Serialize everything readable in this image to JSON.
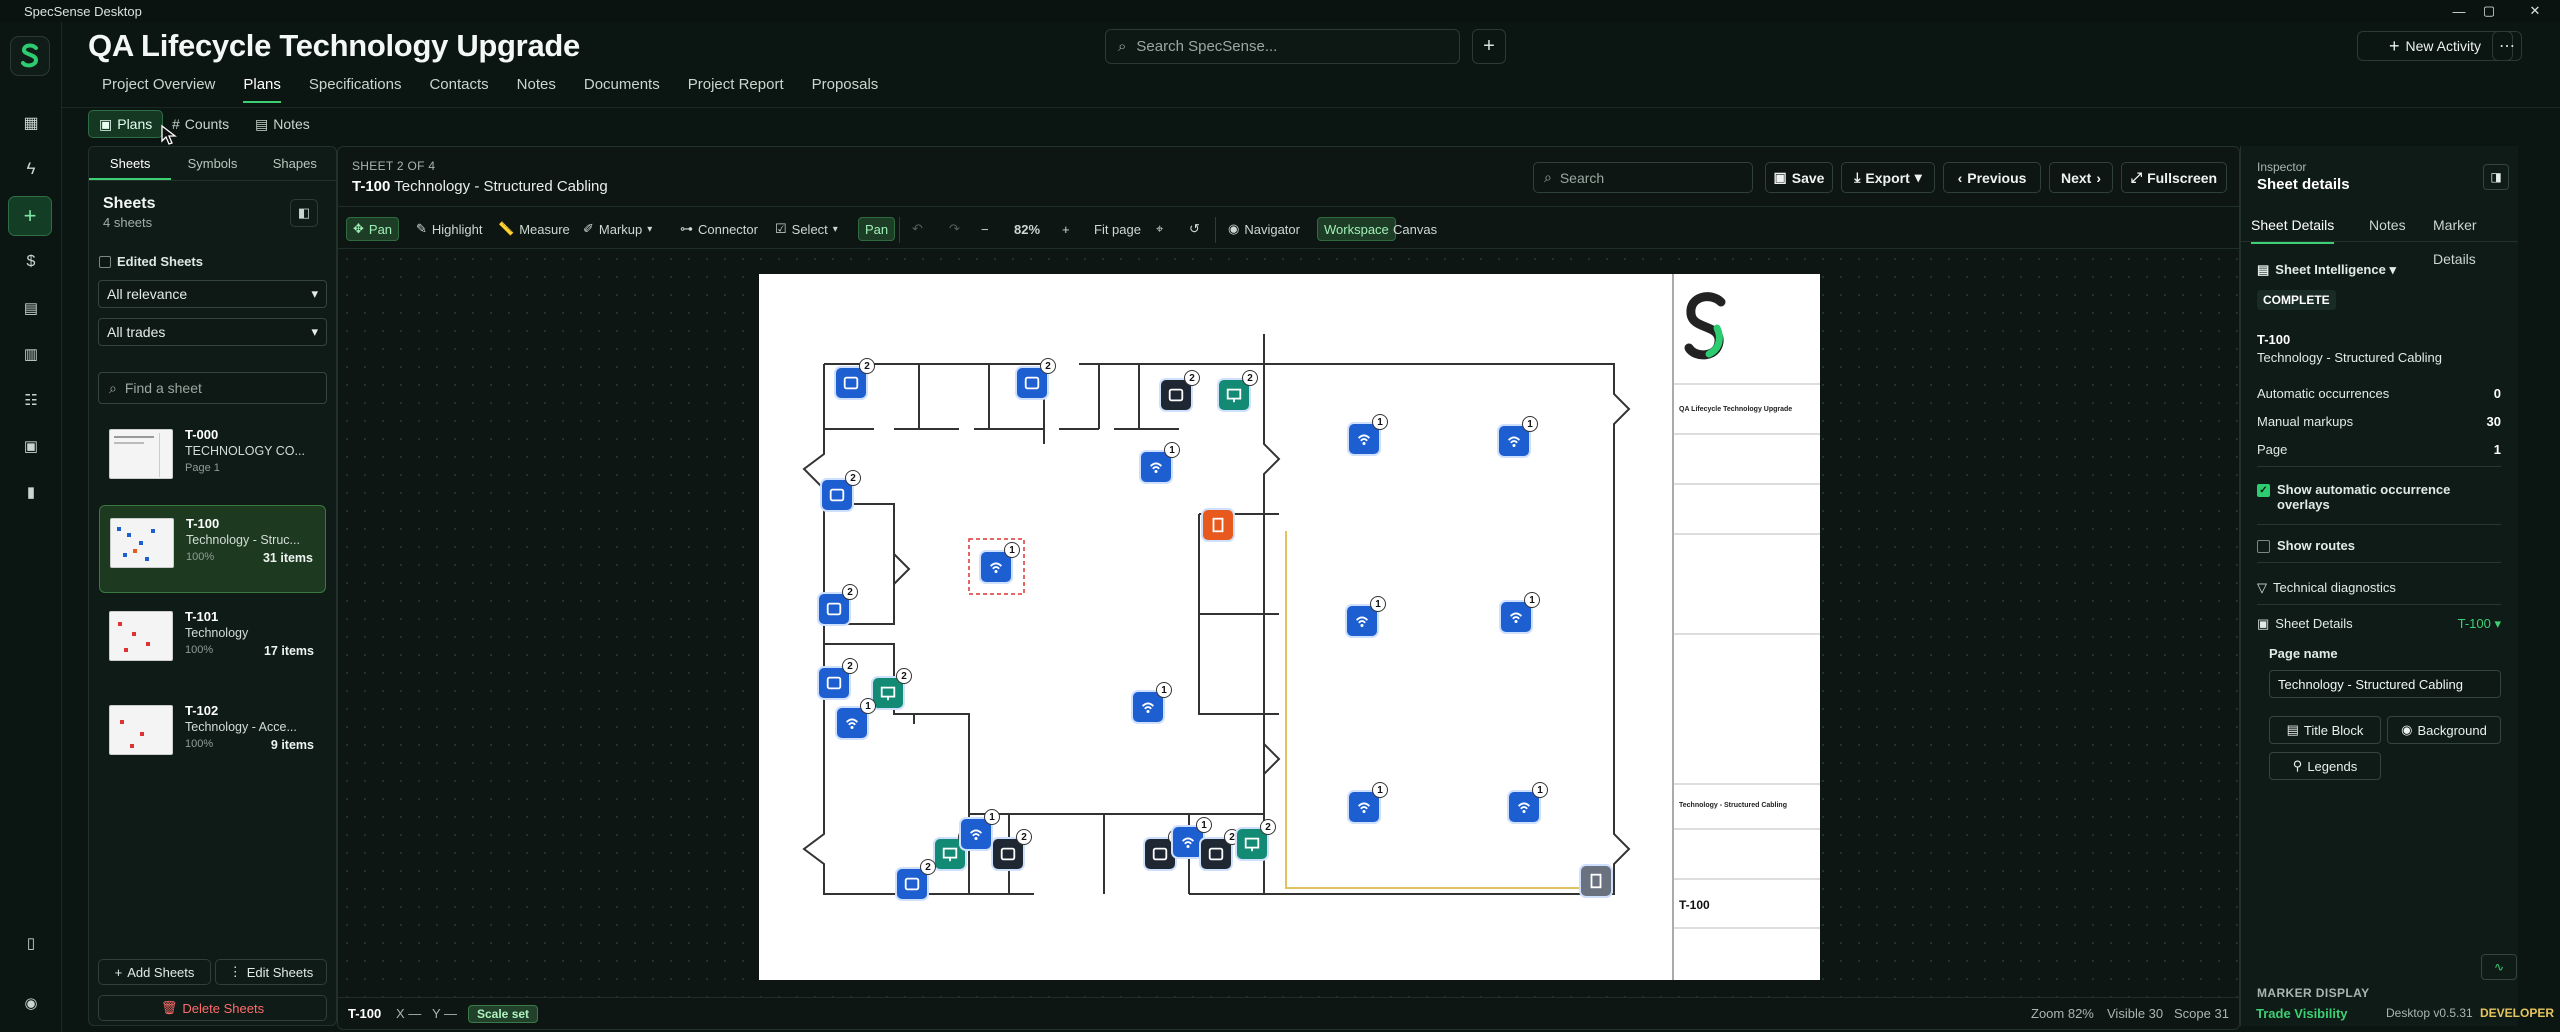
{
  "window": {
    "title": "SpecSense Desktop"
  },
  "project": {
    "title": "QA Lifecycle Technology Upgrade"
  },
  "search": {
    "placeholder": "Search SpecSense..."
  },
  "header": {
    "new_activity": "New Activity"
  },
  "nav": {
    "tabs": [
      "Project Overview",
      "Plans",
      "Specifications",
      "Contacts",
      "Notes",
      "Documents",
      "Project Report",
      "Proposals"
    ],
    "active": "Plans"
  },
  "subtabs": [
    "Plans",
    "Counts",
    "Notes"
  ],
  "left": {
    "tabs": [
      "Sheets",
      "Symbols",
      "Shapes"
    ],
    "heading": "Sheets",
    "count": "4 sheets",
    "edited_label": "Edited Sheets",
    "relevance": "All relevance",
    "trades": "All trades",
    "find_placeholder": "Find a sheet",
    "sheets": [
      {
        "id": "T-000",
        "name": "TECHNOLOGY CO...",
        "meta": "Page 1",
        "items": ""
      },
      {
        "id": "T-100",
        "name": "Technology - Struc...",
        "meta": "100%",
        "items": "31 items"
      },
      {
        "id": "T-101",
        "name": "Technology",
        "meta": "100%",
        "items": "17 items"
      },
      {
        "id": "T-102",
        "name": "Technology - Acce...",
        "meta": "100%",
        "items": "9 items"
      }
    ],
    "add": "Add Sheets",
    "edit": "Edit Sheets",
    "delete": "Delete Sheets"
  },
  "viewer": {
    "sheet_of": "SHEET 2 OF 4",
    "sheet_id": "T-100",
    "sheet_name": "Technology - Structured Cabling",
    "search_placeholder": "Search",
    "save": "Save",
    "export": "Export",
    "previous": "Previous",
    "next": "Next",
    "fullscreen": "Fullscreen",
    "tools": {
      "pan": "Pan",
      "highlight": "Highlight",
      "measure": "Measure",
      "markup": "Markup",
      "connector": "Connector",
      "select": "Select",
      "pan2": "Pan",
      "zoom": "82%",
      "fit": "Fit page",
      "navigator": "Navigator",
      "workspace": "Workspace",
      "canvas": "Canvas"
    },
    "footer": {
      "sheet": "T-100",
      "x": "X —",
      "y": "Y —",
      "scale": "Scale set",
      "zoom": "Zoom 82%",
      "visible": "Visible 30",
      "scope": "Scope 31"
    }
  },
  "titleblock": {
    "project": "QA Lifecycle Technology Upgrade",
    "drawing": "Technology - Structured Cabling",
    "number": "T-100"
  },
  "inspector": {
    "label": "Inspector",
    "title": "Sheet details",
    "tabs": [
      "Sheet Details",
      "Notes",
      "Marker Details"
    ],
    "intelligence": "Sheet Intelligence",
    "status": "COMPLETE",
    "sheet_id": "T-100",
    "sheet_name": "Technology - Structured Cabling",
    "rows": [
      {
        "label": "Automatic occurrences",
        "value": "0"
      },
      {
        "label": "Manual markups",
        "value": "30"
      },
      {
        "label": "Page",
        "value": "1"
      }
    ],
    "show_overlays": "Show automatic occurrence overlays",
    "show_routes": "Show routes",
    "diagnostics": "Technical diagnostics",
    "details": "Sheet Details",
    "details_tag": "T-100",
    "page_name_label": "Page name",
    "page_name": "Technology - Structured Cabling",
    "title_block": "Title Block",
    "background": "Background",
    "legends": "Legends",
    "marker_display": "MARKER DISPLAY",
    "trade_visibility": "Trade Visibility"
  },
  "status": {
    "version": "Desktop v0.5.31",
    "mode": "DEVELOPER"
  },
  "colors": {
    "accent": "#3ecf74",
    "marker_blue": "#1d5fd1",
    "marker_teal": "#138a73",
    "marker_orange": "#e8591e"
  }
}
